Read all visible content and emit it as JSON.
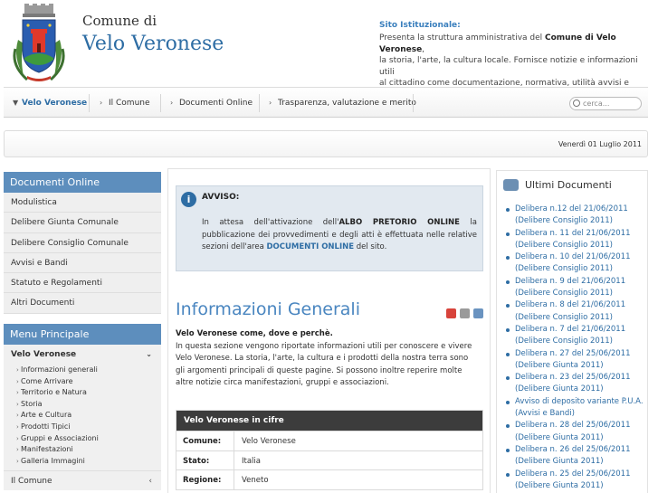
{
  "header": {
    "comune_di": "Comune di",
    "name": "Velo Veronese",
    "sito_title": "Sito Istituzionale:",
    "sito_line1_pre": "Presenta la struttura amministrativa del ",
    "sito_line1_bold": "Comune di Velo Veronese",
    "sito_line1_post": ",",
    "sito_line2": "la storia, l'arte, la cultura locale. Fornisce notizie e informazioni utili",
    "sito_line3": "al cittadino come documentazione, normativa, utilità avvisi e bandi..."
  },
  "nav": {
    "items": [
      {
        "label": "Velo Veronese"
      },
      {
        "label": "Il Comune"
      },
      {
        "label": "Documenti Online"
      },
      {
        "label": "Trasparenza, valutazione e merito"
      }
    ],
    "search_placeholder": "cerca..."
  },
  "datebar": {
    "date": "Venerdì 01 Luglio 2011"
  },
  "docs": {
    "title": "Documenti Online",
    "items": [
      {
        "label": "Modulistica"
      },
      {
        "label": "Delibere Giunta Comunale"
      },
      {
        "label": "Delibere Consiglio Comunale"
      },
      {
        "label": "Avvisi e Bandi"
      },
      {
        "label": "Statuto e Regolamenti"
      },
      {
        "label": "Altri Documenti"
      }
    ]
  },
  "menu": {
    "title": "Menu Principale",
    "section": "Velo Veronese",
    "items": [
      {
        "label": "Informazioni generali"
      },
      {
        "label": "Come Arrivare"
      },
      {
        "label": "Territorio e Natura"
      },
      {
        "label": "Storia"
      },
      {
        "label": "Arte e Cultura"
      },
      {
        "label": "Prodotti Tipici"
      },
      {
        "label": "Gruppi e Associazioni"
      },
      {
        "label": "Manifestazioni"
      },
      {
        "label": "Galleria Immagini"
      }
    ],
    "il_comune": "Il Comune"
  },
  "avviso": {
    "title": "AVVISO:",
    "text_pre": "In attesa dell'attivazione dell'",
    "text_bold": "ALBO PRETORIO ONLINE",
    "text_mid": " la pubblicazione dei provvedimenti e degli atti è effettuata nelle relative sezioni dell'area ",
    "text_link": "DOCUMENTI ONLINE",
    "text_post": " del sito."
  },
  "info": {
    "title": "Informazioni Generali",
    "intro_bold": "Velo Veronese come, dove e perchè.",
    "intro_text": "In questa sezione vengono riportate informazioni utili per conoscere e vivere Velo Veronese. La storia, l'arte, la cultura e i prodotti della nostra terra sono gli argomenti principali di queste pagine. Si possono inoltre reperire molte altre notizie circa manifestazioni, gruppi e associazioni."
  },
  "facts": {
    "title": "Velo Veronese in cifre",
    "rows": [
      {
        "key": "Comune:",
        "value": "Velo Veronese"
      },
      {
        "key": "Stato:",
        "value": "Italia"
      },
      {
        "key": "Regione:",
        "value": "Veneto"
      }
    ]
  },
  "ultimi": {
    "title": "Ultimi Documenti",
    "items": [
      {
        "title": "Delibera n.12 del 21/06/2011",
        "category": "(Delibere Consiglio 2011)"
      },
      {
        "title": "Delibera n. 11 del 21/06/2011",
        "category": "(Delibere Consiglio 2011)"
      },
      {
        "title": "Delibera n. 10 del 21/06/2011",
        "category": "(Delibere Consiglio 2011)"
      },
      {
        "title": "Delibera n. 9 del 21/06/2011",
        "category": "(Delibere Consiglio 2011)"
      },
      {
        "title": "Delibera n. 8 del 21/06/2011",
        "category": "(Delibere Consiglio 2011)"
      },
      {
        "title": "Delibera n. 7 del 21/06/2011",
        "category": "(Delibere Consiglio 2011)"
      },
      {
        "title": "Delibera n. 27 del 25/06/2011",
        "category": "(Delibere Giunta 2011)"
      },
      {
        "title": "Delibera n. 23 del 25/06/2011",
        "category": "(Delibere Giunta 2011)"
      },
      {
        "title": "Avviso di deposito variante P.U.A.",
        "category": "(Avvisi e Bandi)"
      },
      {
        "title": "Delibera n. 28 del 25/06/2011",
        "category": "(Delibere Giunta 2011)"
      },
      {
        "title": "Delibera n. 26 del 25/06/2011",
        "category": "(Delibere Giunta 2011)"
      },
      {
        "title": "Delibera n. 25 del 25/06/2011",
        "category": "(Delibere Giunta 2011)"
      }
    ]
  },
  "colors": {
    "accent": "#2e6da4",
    "box_header": "#5d8ebd",
    "facts_header": "#3c3c3c"
  }
}
